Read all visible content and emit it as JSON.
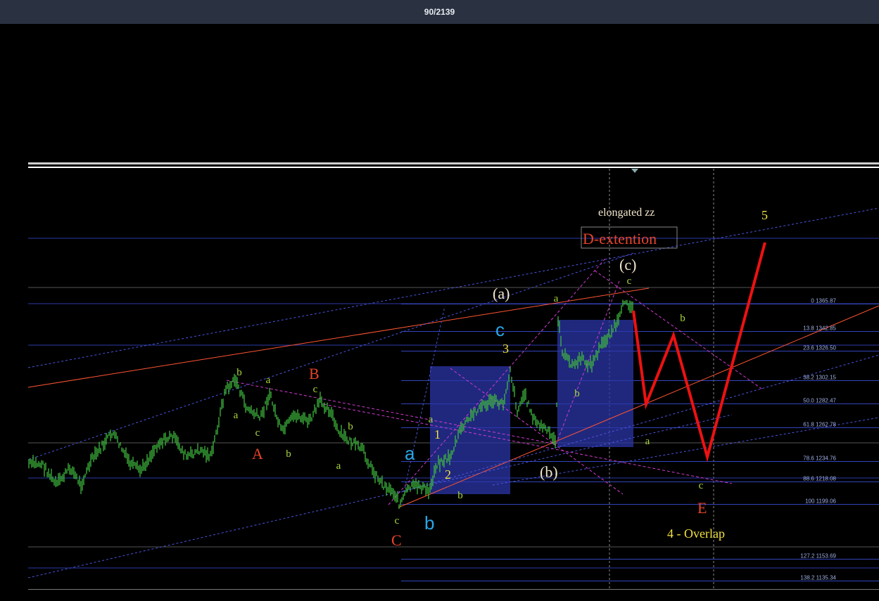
{
  "header": {
    "counter": "90/2139"
  },
  "chart_data": {
    "type": "line",
    "fib_levels": [
      {
        "pct": "0",
        "price": "1365.87"
      },
      {
        "pct": "13.8",
        "price": "1342.85"
      },
      {
        "pct": "23.6",
        "price": "1326.50"
      },
      {
        "pct": "38.2",
        "price": "1302.15"
      },
      {
        "pct": "50.0",
        "price": "1282.47"
      },
      {
        "pct": "61.8",
        "price": "1262.78"
      },
      {
        "pct": "78.6",
        "price": "1234.76"
      },
      {
        "pct": "88.6",
        "price": "1218.08"
      },
      {
        "pct": "100",
        "price": "1199.06"
      },
      {
        "pct": "127.2",
        "price": "1153.69"
      },
      {
        "pct": "138.2",
        "price": "1135.34"
      }
    ],
    "annotations": {
      "elongated": "elongated zz",
      "d_ext": "D-extention",
      "overlap": "4 - Overlap",
      "w_A": "A",
      "w_B": "B",
      "w_C": "C",
      "w_D_c": "(c)",
      "w_D_a": "(a)",
      "w_D_b": "(b)",
      "w_E": "E",
      "w_5": "5",
      "w_c_blue": "c",
      "w_a_blue": "a",
      "w_b_blue": "b",
      "n1": "1",
      "n2": "2",
      "n3": "3"
    },
    "colors": {
      "candles": "#3fb83f",
      "fib": "#3344aa",
      "red_path": "#ee1111",
      "box": "#2b35a8",
      "label_red": "#e8442a",
      "label_blue": "#29a6e8",
      "label_yellow": "#f0e040",
      "label_green": "#a8d83a",
      "label_white": "#f2e6cc"
    },
    "grid": false,
    "legend": "none"
  }
}
